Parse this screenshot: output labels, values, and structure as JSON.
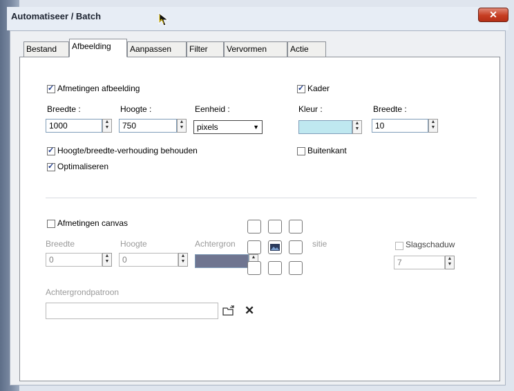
{
  "window": {
    "title": "Automatiseer / Batch",
    "close_label": "✕"
  },
  "tabs": [
    "Bestand",
    "Afbeelding",
    "Aanpassen",
    "Filter",
    "Vervormen",
    "Actie"
  ],
  "image_size": {
    "label": "Afmetingen afbeelding",
    "width_label": "Breedte :",
    "width_value": "1000",
    "height_label": "Hoogte :",
    "height_value": "750",
    "unit_label": "Eenheid :",
    "unit_value": "pixels",
    "keep_ratio_label": "Hoogte/breedte-verhouding behouden",
    "optimize_label": "Optimaliseren"
  },
  "frame": {
    "label": "Kader",
    "color_label": "Kleur :",
    "color_value": "#bfe8f0",
    "width_label": "Breedte :",
    "width_value": "10",
    "outside_label": "Buitenkant"
  },
  "canvas": {
    "label": "Afmetingen canvas",
    "width_label": "Breedte",
    "width_value": "0",
    "height_label": "Hoogte",
    "height_value": "0",
    "background_label": "Achtergron",
    "background_color": "#6f7590",
    "position_label": "sitie",
    "shadow_label": "Slagschaduw",
    "shadow_value": "7",
    "pattern_label": "Achtergrondpatroon",
    "pattern_value": "",
    "close_icon_label": "✕"
  }
}
